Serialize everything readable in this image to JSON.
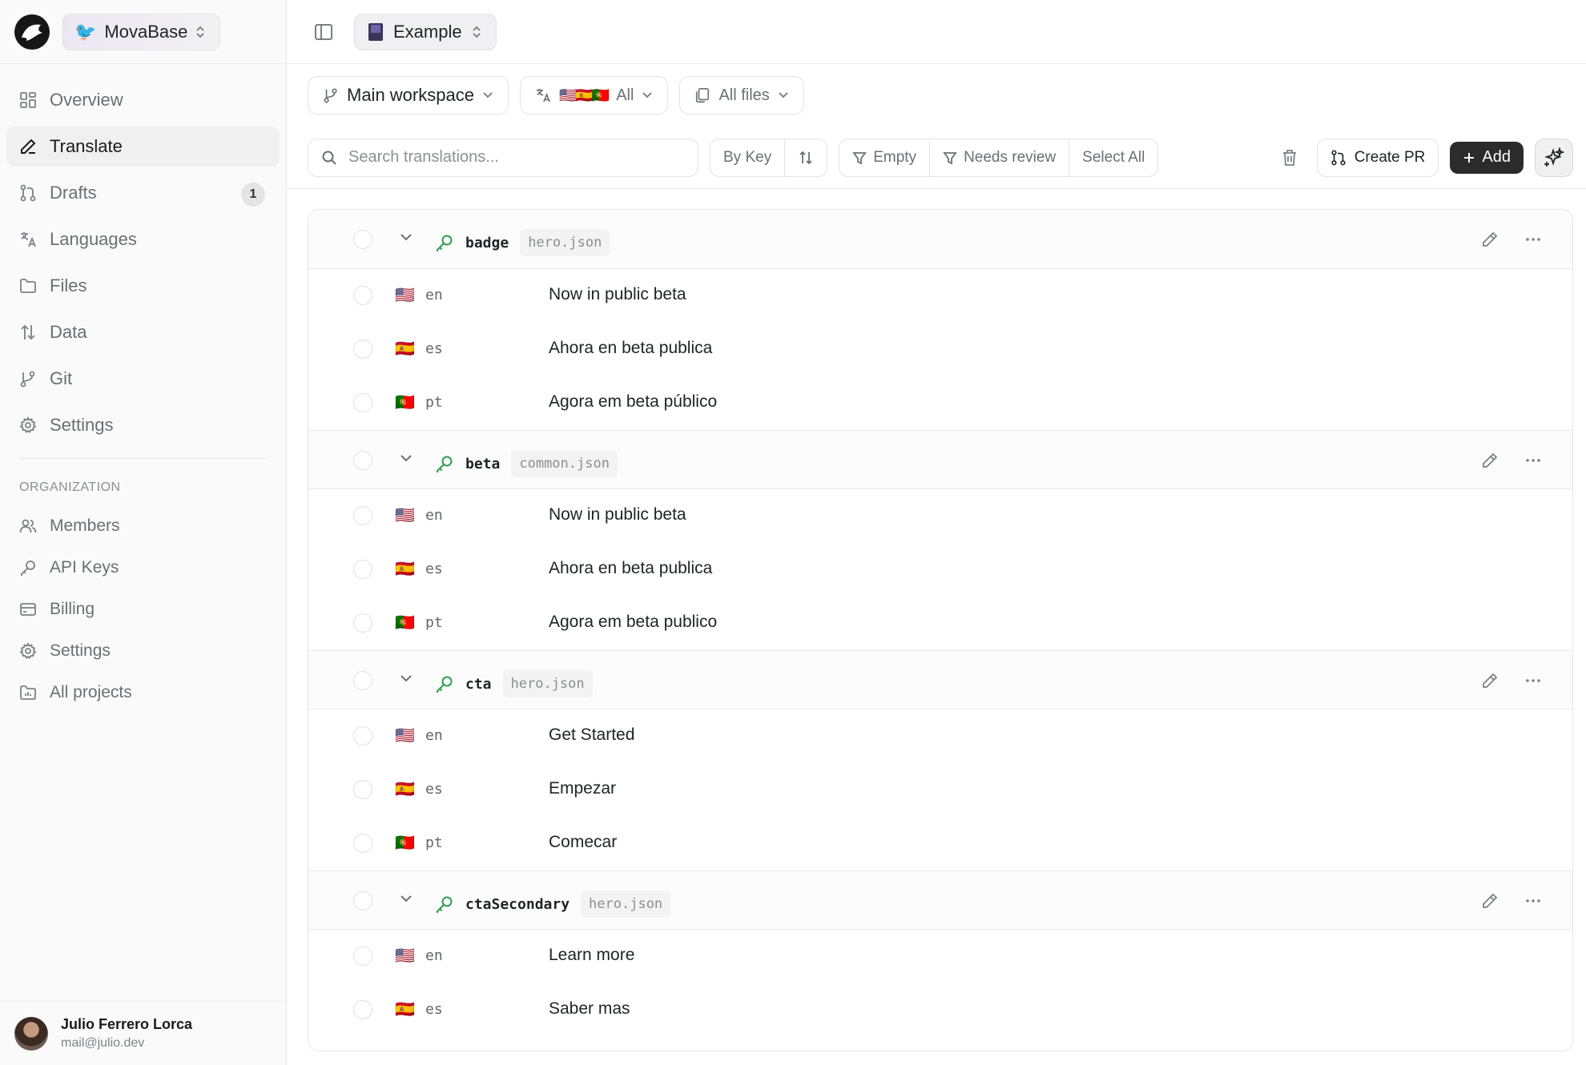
{
  "brand": {
    "workspace": "MovaBase"
  },
  "project": {
    "name": "Example"
  },
  "nav": {
    "items": [
      {
        "label": "Overview",
        "icon": "grid-icon"
      },
      {
        "label": "Translate",
        "icon": "pen-icon",
        "active": true
      },
      {
        "label": "Drafts",
        "icon": "git-pull-icon",
        "badge": "1"
      },
      {
        "label": "Languages",
        "icon": "translate-icon"
      },
      {
        "label": "Files",
        "icon": "folder-icon"
      },
      {
        "label": "Data",
        "icon": "arrows-icon"
      },
      {
        "label": "Git",
        "icon": "git-branch-icon"
      },
      {
        "label": "Settings",
        "icon": "gear-icon"
      }
    ],
    "org_label": "ORGANIZATION",
    "org_items": [
      {
        "label": "Members",
        "icon": "users-icon"
      },
      {
        "label": "API Keys",
        "icon": "key-icon"
      },
      {
        "label": "Billing",
        "icon": "card-icon"
      },
      {
        "label": "Settings",
        "icon": "gear-icon"
      },
      {
        "label": "All projects",
        "icon": "folder-chart-icon"
      }
    ]
  },
  "user": {
    "name": "Julio Ferrero Lorca",
    "email": "mail@julio.dev"
  },
  "filters": {
    "workspace": "Main workspace",
    "languages_label": "All",
    "languages_flags": "🇺🇸🇪🇸🇵🇹",
    "files": "All files"
  },
  "toolbar": {
    "search_placeholder": "Search translations...",
    "sort_label": "By Key",
    "empty_label": "Empty",
    "review_label": "Needs review",
    "select_all_label": "Select All",
    "create_pr_label": "Create PR",
    "add_label": "Add"
  },
  "groups": [
    {
      "key": "badge",
      "file": "hero.json",
      "rows": [
        {
          "flag": "🇺🇸",
          "lang": "en",
          "value": "Now in public beta"
        },
        {
          "flag": "🇪🇸",
          "lang": "es",
          "value": "Ahora en beta publica"
        },
        {
          "flag": "🇵🇹",
          "lang": "pt",
          "value": "Agora em beta público"
        }
      ]
    },
    {
      "key": "beta",
      "file": "common.json",
      "rows": [
        {
          "flag": "🇺🇸",
          "lang": "en",
          "value": "Now in public beta"
        },
        {
          "flag": "🇪🇸",
          "lang": "es",
          "value": "Ahora en beta publica"
        },
        {
          "flag": "🇵🇹",
          "lang": "pt",
          "value": "Agora em beta publico"
        }
      ]
    },
    {
      "key": "cta",
      "file": "hero.json",
      "rows": [
        {
          "flag": "🇺🇸",
          "lang": "en",
          "value": "Get Started"
        },
        {
          "flag": "🇪🇸",
          "lang": "es",
          "value": "Empezar"
        },
        {
          "flag": "🇵🇹",
          "lang": "pt",
          "value": "Comecar"
        }
      ]
    },
    {
      "key": "ctaSecondary",
      "file": "hero.json",
      "rows": [
        {
          "flag": "🇺🇸",
          "lang": "en",
          "value": "Learn more"
        },
        {
          "flag": "🇪🇸",
          "lang": "es",
          "value": "Saber mas"
        }
      ]
    }
  ],
  "colors": {
    "key_icon": "#2e9e4e",
    "primary_button": "#2b2b2b"
  }
}
